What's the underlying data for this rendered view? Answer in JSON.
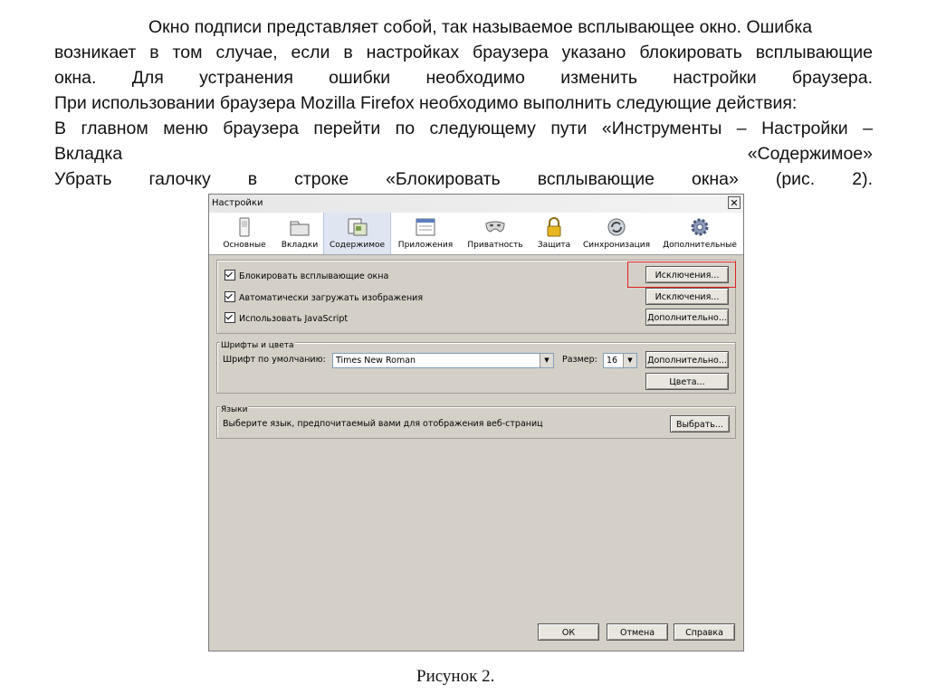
{
  "text": {
    "line1": "Окно подписи представляет собой, так называемое всплывающее окно. Ошибка",
    "line2": "возникает в том случае, если в настройках браузера указано блокировать всплывающие",
    "line3": "окна. Для устранения ошибки необходимо изменить настройки браузера.",
    "line4": "При использовании браузера Mozilla Firefox необходимо выполнить следующие действия:",
    "line5": "В главном меню браузера перейти по следующему пути «Инструменты – Настройки –",
    "line6a": "Вкладка",
    "line6b": "«Содержимое»",
    "line7": "Убрать галочку в строке «Блокировать всплывающие окна» (рис. 2)."
  },
  "dialog": {
    "title": "Настройки",
    "close_glyph": "✕",
    "tabs": [
      {
        "label": "Основные",
        "icon": "switch-icon"
      },
      {
        "label": "Вкладки",
        "icon": "folder-tabs-icon"
      },
      {
        "label": "Содержимое",
        "icon": "content-icon",
        "selected": true
      },
      {
        "label": "Приложения",
        "icon": "applications-icon"
      },
      {
        "label": "Приватность",
        "icon": "mask-icon"
      },
      {
        "label": "Защита",
        "icon": "lock-icon"
      },
      {
        "label": "Синхронизация",
        "icon": "sync-icon"
      },
      {
        "label": "Дополнительные",
        "icon": "gear-icon"
      }
    ],
    "content": {
      "block_popups": "Блокировать всплывающие окна",
      "auto_images": "Автоматически загружать изображения",
      "use_js": "Использовать JavaScript",
      "exceptions1": "Исключения...",
      "exceptions2": "Исключения...",
      "advanced_js": "Дополнительно..."
    },
    "fonts": {
      "group_title": "Шрифты и цвета",
      "default_label": "Шрифт по умолчанию:",
      "default_value": "Times New Roman",
      "size_label": "Размер:",
      "size_value": "16",
      "advanced": "Дополнительно...",
      "colors": "Цвета..."
    },
    "languages": {
      "group_title": "Языки",
      "desc": "Выберите язык, предпочитаемый вами для отображения веб-страниц",
      "choose": "Выбрать..."
    },
    "buttons": {
      "ok": "ОК",
      "cancel": "Отмена",
      "help": "Справка"
    },
    "highlight_color": "#e02020"
  },
  "caption": "Рисунок 2."
}
